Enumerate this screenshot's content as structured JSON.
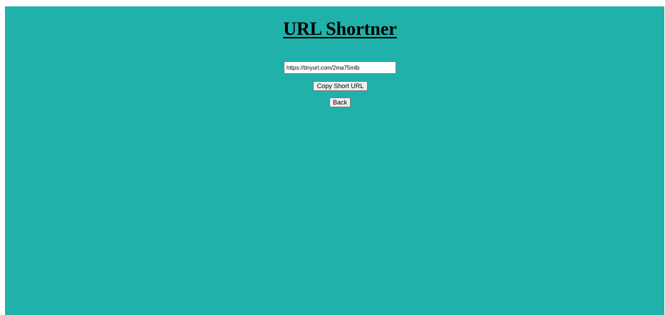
{
  "page": {
    "title": "URL Shortner",
    "background_color": "#20b2aa"
  },
  "form": {
    "short_url_value": "https://tinyurl.com/2ma75mlb",
    "copy_button_label": "Copy Short URL",
    "back_button_label": "Back"
  }
}
